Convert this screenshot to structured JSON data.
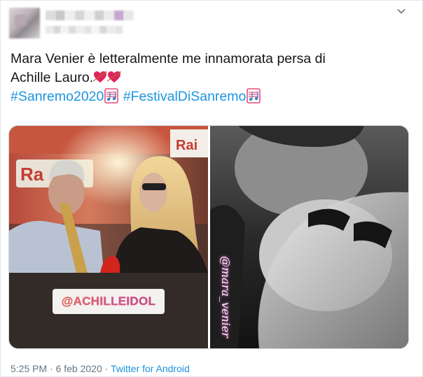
{
  "tweet": {
    "text_line1": "Mara Venier è letteralmente me innamorata persa di",
    "text_line2": "Achille Lauro.",
    "hashtags": [
      "#Sanremo2020",
      "#FestivalDiSanremo"
    ],
    "timestamp": "5:25 PM · 6 feb 2020 · ",
    "source": "Twitter for Android"
  },
  "media": {
    "left_sticker": "@ACHILLEIDOL",
    "left_sign_text": "Rai",
    "left_sign_text2": "Radio",
    "right_tag": "@mara_venier"
  },
  "icons": {
    "menu": "chevron-down-icon",
    "heart": "heart-with-arrow-icon",
    "music": "musical-score-icon"
  },
  "colors": {
    "hashtag": "#1b95e0",
    "meta": "#657786",
    "text": "#14171a",
    "border": "#e1e8ed"
  }
}
